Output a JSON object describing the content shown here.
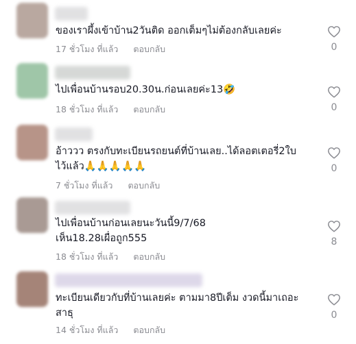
{
  "comments": [
    {
      "text": "ของเราผึ้งเข้าบ้าน2วันติด ออกเต็มๆไม่ต้องกลับเลยค่ะ",
      "time": "17 ชั่วโมง ที่แล้ว",
      "reply": "ตอบกลับ",
      "likes": "0",
      "avatar_color": "#b9a8a0",
      "name_color": "#dcdcde"
    },
    {
      "text": "ไปเพื่อนบ้านรอบ20.30น.ก่อนเลยค่ะ13🤣",
      "time": "18 ชั่วโมง ที่แล้ว",
      "reply": "ตอบกลับ",
      "likes": "0",
      "avatar_color": "#9fc6a8",
      "name_color": "#cfd2d0"
    },
    {
      "text": "อ้าววว ตรงกับทะเบียนรถยนต์ที่บ้านเลย..ได้ลอตเตอรี่2ใบ\nไว้แล้ว🙏🙏🙏🙏🙏",
      "time": "7 ชั่วโมง ที่แล้ว",
      "reply": "ตอบกลับ",
      "likes": "0",
      "avatar_color": "#b79488",
      "name_color": "#dcdcde"
    },
    {
      "text": "ไปเพื่อนบ้านก่อนเลยนะวันนี้9/7/68\nเห็น18.28เผื่อถูก555",
      "time": "18 ชั่วโมง ที่แล้ว",
      "reply": "ตอบกลับ",
      "likes": "8",
      "avatar_color": "#a99a94",
      "name_color": "#dcdcde"
    },
    {
      "text": "ทะเบียนเดียวกับที่บ้านเลยค่ะ ตามมา8ปีเต็ม งวดนี้มาเถอะ\nสาธุ",
      "time": "14 ชั่วโมง ที่แล้ว",
      "reply": "ตอบกลับ",
      "likes": "0",
      "avatar_color": "#a58478",
      "name_color": "#d8d2e6"
    }
  ]
}
